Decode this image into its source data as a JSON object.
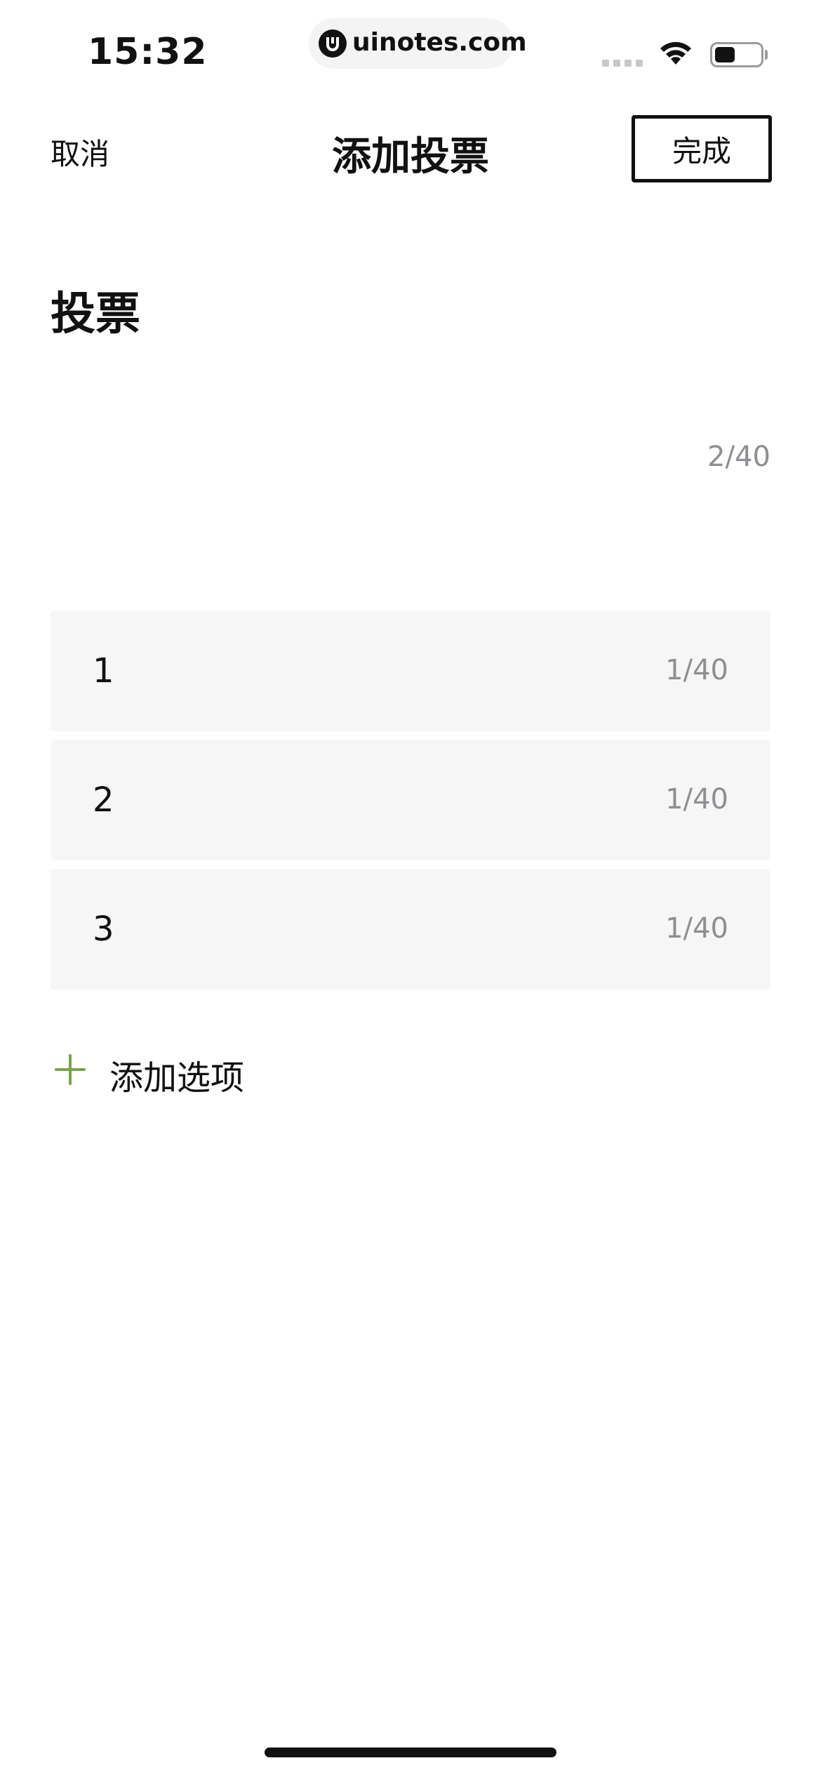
{
  "status_bar": {
    "time": "15:32",
    "url": "uinotes.com",
    "battery_level": 0.45
  },
  "nav": {
    "cancel_label": "取消",
    "title": "添加投票",
    "done_label": "完成"
  },
  "vote": {
    "heading": "投票",
    "title_counter": "2/40"
  },
  "options": [
    {
      "text": "1",
      "counter": "1/40"
    },
    {
      "text": "2",
      "counter": "1/40"
    },
    {
      "text": "3",
      "counter": "1/40"
    }
  ],
  "add_option": {
    "label": "添加选项",
    "icon": "plus-icon"
  },
  "colors": {
    "accent": "#7aa24c",
    "option_bg": "#f6f6f6",
    "counter_text": "#8e8e93"
  }
}
